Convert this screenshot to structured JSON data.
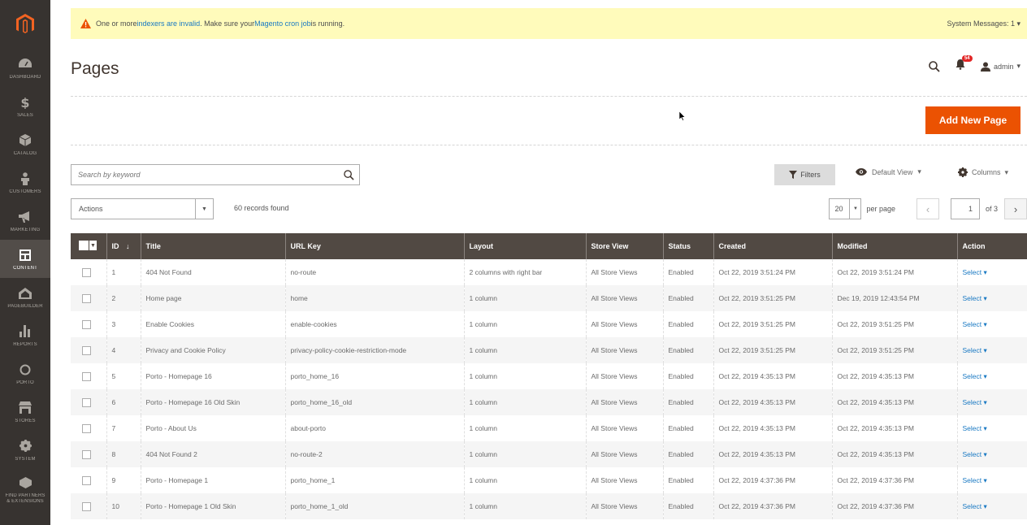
{
  "sidebar": {
    "items": [
      {
        "label": "Dashboard",
        "icon": "dashboard-icon"
      },
      {
        "label": "Sales",
        "icon": "dollar-icon"
      },
      {
        "label": "Catalog",
        "icon": "cube-icon"
      },
      {
        "label": "Customers",
        "icon": "person-icon"
      },
      {
        "label": "Marketing",
        "icon": "megaphone-icon"
      },
      {
        "label": "Content",
        "icon": "layout-icon"
      },
      {
        "label": "Pagebuilder",
        "icon": "pagebuilder-icon"
      },
      {
        "label": "Reports",
        "icon": "bar-chart-icon"
      },
      {
        "label": "Porto",
        "icon": "circle-icon"
      },
      {
        "label": "Stores",
        "icon": "store-icon"
      },
      {
        "label": "System",
        "icon": "gear-icon"
      },
      {
        "label": "Find Partners",
        "label2": "& Extensions",
        "icon": "partners-icon"
      }
    ]
  },
  "message": {
    "prefix": "One or more ",
    "link1": "indexers are invalid",
    "middle": ". Make sure your ",
    "link2": "Magento cron job",
    "suffix": " is running.",
    "system_messages": "System Messages: 1"
  },
  "header": {
    "title": "Pages",
    "notifications_count": "54",
    "user": "admin"
  },
  "toolbar": {
    "add_new_label": "Add New Page",
    "search_placeholder": "Search by keyword",
    "filters_label": "Filters",
    "view_label": "Default View",
    "columns_label": "Columns",
    "actions_label": "Actions",
    "records_found": "60 records found",
    "per_page_value": "20",
    "per_page_label": "per page",
    "current_page": "1",
    "total_pages_label": "of 3"
  },
  "table": {
    "headers": {
      "id": "ID",
      "title": "Title",
      "url_key": "URL Key",
      "layout": "Layout",
      "store_view": "Store View",
      "status": "Status",
      "created": "Created",
      "modified": "Modified",
      "action": "Action"
    },
    "rows": [
      {
        "id": "1",
        "title": "404 Not Found",
        "url_key": "no-route",
        "layout": "2 columns with right bar",
        "store_view": "All Store Views",
        "status": "Enabled",
        "created": "Oct 22, 2019 3:51:24 PM",
        "modified": "Oct 22, 2019 3:51:24 PM",
        "action": "Select"
      },
      {
        "id": "2",
        "title": "Home page",
        "url_key": "home",
        "layout": "1 column",
        "store_view": "All Store Views",
        "status": "Enabled",
        "created": "Oct 22, 2019 3:51:25 PM",
        "modified": "Dec 19, 2019 12:43:54 PM",
        "action": "Select"
      },
      {
        "id": "3",
        "title": "Enable Cookies",
        "url_key": "enable-cookies",
        "layout": "1 column",
        "store_view": "All Store Views",
        "status": "Enabled",
        "created": "Oct 22, 2019 3:51:25 PM",
        "modified": "Oct 22, 2019 3:51:25 PM",
        "action": "Select"
      },
      {
        "id": "4",
        "title": "Privacy and Cookie Policy",
        "url_key": "privacy-policy-cookie-restriction-mode",
        "layout": "1 column",
        "store_view": "All Store Views",
        "status": "Enabled",
        "created": "Oct 22, 2019 3:51:25 PM",
        "modified": "Oct 22, 2019 3:51:25 PM",
        "action": "Select"
      },
      {
        "id": "5",
        "title": "Porto - Homepage 16",
        "url_key": "porto_home_16",
        "layout": "1 column",
        "store_view": "All Store Views",
        "status": "Enabled",
        "created": "Oct 22, 2019 4:35:13 PM",
        "modified": "Oct 22, 2019 4:35:13 PM",
        "action": "Select"
      },
      {
        "id": "6",
        "title": "Porto - Homepage 16 Old Skin",
        "url_key": "porto_home_16_old",
        "layout": "1 column",
        "store_view": "All Store Views",
        "status": "Enabled",
        "created": "Oct 22, 2019 4:35:13 PM",
        "modified": "Oct 22, 2019 4:35:13 PM",
        "action": "Select"
      },
      {
        "id": "7",
        "title": "Porto - About Us",
        "url_key": "about-porto",
        "layout": "1 column",
        "store_view": "All Store Views",
        "status": "Enabled",
        "created": "Oct 22, 2019 4:35:13 PM",
        "modified": "Oct 22, 2019 4:35:13 PM",
        "action": "Select"
      },
      {
        "id": "8",
        "title": "404 Not Found 2",
        "url_key": "no-route-2",
        "layout": "1 column",
        "store_view": "All Store Views",
        "status": "Enabled",
        "created": "Oct 22, 2019 4:35:13 PM",
        "modified": "Oct 22, 2019 4:35:13 PM",
        "action": "Select"
      },
      {
        "id": "9",
        "title": "Porto - Homepage 1",
        "url_key": "porto_home_1",
        "layout": "1 column",
        "store_view": "All Store Views",
        "status": "Enabled",
        "created": "Oct 22, 2019 4:37:36 PM",
        "modified": "Oct 22, 2019 4:37:36 PM",
        "action": "Select"
      },
      {
        "id": "10",
        "title": "Porto - Homepage 1 Old Skin",
        "url_key": "porto_home_1_old",
        "layout": "1 column",
        "store_view": "All Store Views",
        "status": "Enabled",
        "created": "Oct 22, 2019 4:37:36 PM",
        "modified": "Oct 22, 2019 4:37:36 PM",
        "action": "Select"
      }
    ]
  },
  "colors": {
    "sidebar_bg": "#373330",
    "accent_orange": "#eb5202",
    "table_header": "#514943",
    "link_blue": "#1979c3",
    "message_bg": "#fffbbb"
  }
}
